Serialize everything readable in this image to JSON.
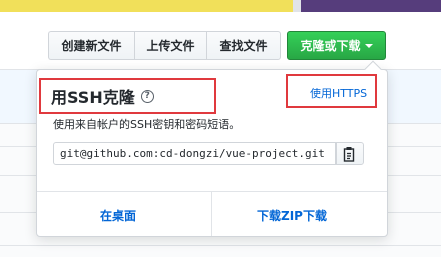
{
  "lang_bar": {
    "colors": [
      "#f1e05a",
      "#563d7c"
    ]
  },
  "toolbar": {
    "create_file": "创建新文件",
    "upload_files": "上传文件",
    "find_file": "查找文件",
    "clone_download": "克隆或下载"
  },
  "clone_panel": {
    "title": "用SSH克隆",
    "help_icon": "question-circle-icon",
    "use_https": "使用HTTPS",
    "description": "使用来自帐户的SSH密钥和密码短语。",
    "clone_url": "git@github.com:cd-dongzi/vue-project.git",
    "copy_icon": "clipboard-icon",
    "open_desktop": "在桌面",
    "download_zip": "下载ZIP下载"
  },
  "colors": {
    "accent_green": "#28a745",
    "link_blue": "#0366d6",
    "highlight_red": "#e0393e"
  }
}
